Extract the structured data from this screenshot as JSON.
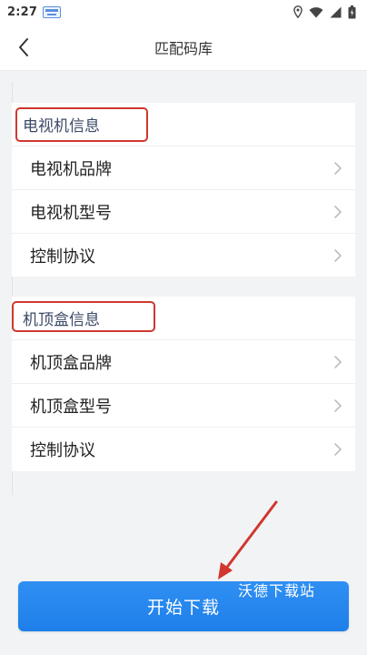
{
  "status_bar": {
    "time": "2:27",
    "icons": [
      "notification-icon",
      "location-icon",
      "wifi-icon",
      "signal-icon",
      "battery-icon"
    ]
  },
  "title_bar": {
    "title": "匹配码库",
    "back_icon": "chevron-left-icon"
  },
  "tv_section": {
    "header": "电视机信息",
    "rows": [
      {
        "label": "电视机品牌"
      },
      {
        "label": "电视机型号"
      },
      {
        "label": "控制协议"
      }
    ]
  },
  "stb_section": {
    "header": "机顶盒信息",
    "rows": [
      {
        "label": "机顶盒品牌"
      },
      {
        "label": "机顶盒型号"
      },
      {
        "label": "控制协议"
      }
    ]
  },
  "primary_button": {
    "label": "开始下载"
  },
  "watermark": "沃德下载站",
  "colors": {
    "accent": "#1e7fe9",
    "highlight": "#d0372e",
    "background": "#f2f3f5"
  }
}
